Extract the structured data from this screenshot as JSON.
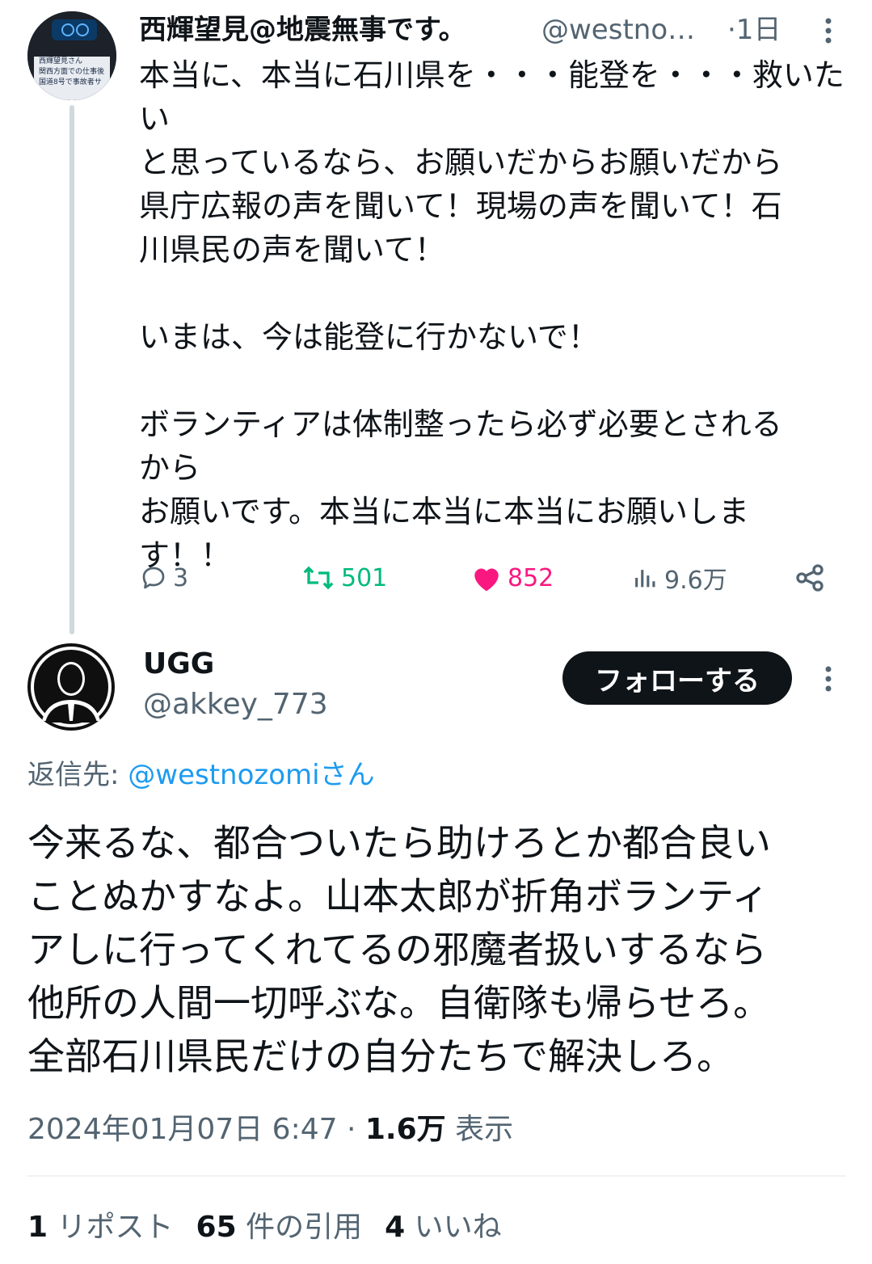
{
  "parent_tweet": {
    "display_name": "西輝望見@地震無事です。",
    "handle": "@westno…",
    "time": "·1日",
    "avatar_caption_lines": [
      "西輝望見さん",
      "関西方面での仕事後",
      "国道8号で事故者サ"
    ],
    "body": "本当に、本当に石川県を・・・能登を・・・救いたい\nと思っているなら、お願いだからお願いだから\n県庁広報の声を聞いて！現場の声を聞いて！石\n川県民の声を聞いて！\n\nいまは、今は能登に行かないで！\n\nボランティアは体制整ったら必ず必要とされる\nから\nお願いです。本当に本当に本当にお願いしま\nす！！",
    "replies": "3",
    "retweets": "501",
    "likes": "852",
    "views": "9.6万"
  },
  "reply_tweet": {
    "display_name": "UGG",
    "handle": "@akkey_773",
    "follow_label": "フォローする",
    "reply_to_prefix": "返信先: ",
    "reply_to_link": "@westnozomiさん",
    "body": "今来るな、都合ついたら助けろとか都合良い\nことぬかすなよ。山本太郎が折角ボランティ\nアしに行ってくれてるの邪魔者扱いするなら\n他所の人間一切呼ぶな。自衛隊も帰らせろ。\n全部石川県民だけの自分たちで解決しろ。",
    "timestamp": "2024年01月07日 6:47 · ",
    "view_count": "1.6万",
    "view_label": " 表示",
    "repost_count": "1",
    "repost_label": " リポスト",
    "quote_count": "65",
    "quote_label": " 件の引用",
    "like_count": "4",
    "like_label": " いいね"
  },
  "colors": {
    "text": "#0f1419",
    "secondary": "#536471",
    "link": "#1d9bf0",
    "retweet": "#00ba7c",
    "like": "#f91880"
  }
}
